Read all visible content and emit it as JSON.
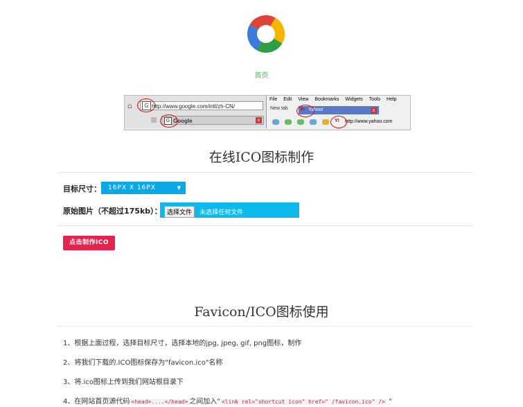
{
  "logo": {
    "colors": [
      "#3c7bd6",
      "#2f9e45",
      "#f4b400",
      "#db4437"
    ],
    "icon": "color-ring-logo"
  },
  "nav": {
    "home_label": "首页"
  },
  "demo_image": {
    "google_url": "http://www.google.com/intl/zh-CN/",
    "google_tab": "Google",
    "menu": [
      "File",
      "Edit",
      "View",
      "Bookmarks",
      "Widgets",
      "Tools",
      "Help"
    ],
    "new_tab": "New tab",
    "yahoo_tab": "Yahoo!",
    "yahoo_url": "http://www.yahoo.com"
  },
  "maker": {
    "title": "在线ICO图标制作",
    "size_label": "目标尺寸：",
    "size_value": "16PX  X  16PX",
    "image_label": "原始图片（不超过175kb）：",
    "file_button": "选择文件",
    "file_status": "未选择任何文件",
    "submit_label": "点击制作ICO"
  },
  "usage": {
    "title": "Favicon/ICO图标使用",
    "step1": "1、根据上面过程，选择目标尺寸，选择本地的jpg, jpeg, gif, png图标，制作",
    "step2": "2、将我们下载的.ICO图标保存为\"favicon.ico\"名称",
    "step3": "3、将.ico图标上传到我们网站根目录下",
    "step4_pre": "4、在网站首页源代码",
    "step4_code1": "<head>....</head>",
    "step4_mid": "之间加入\"",
    "step4_code2": "<link rel=\"shortcut icon\" href=\" /favicon.ico\" />",
    "step4_post": " \""
  }
}
